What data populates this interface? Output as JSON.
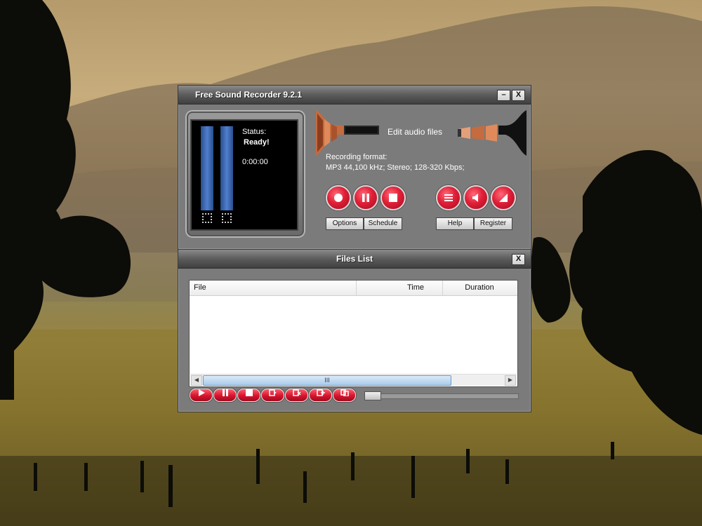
{
  "main_window": {
    "title": "Free Sound Recorder 9.2.1",
    "minimize_glyph": "–",
    "close_glyph": "X"
  },
  "display": {
    "status_label": "Status:",
    "status_value": "Ready!",
    "time": "0:00:00"
  },
  "recording": {
    "edit_audio_label": "Edit audio files",
    "format_label": "Recording format:",
    "format_value": "MP3 44,100 kHz; Stereo;  128-320 Kbps;"
  },
  "buttons": {
    "options": "Options",
    "schedule": "Schedule",
    "help": "Help",
    "register": "Register"
  },
  "files_window": {
    "title": "Files List",
    "close_glyph": "X",
    "columns": [
      "File",
      "Time",
      "Duration"
    ],
    "scroll_thumb_glyph": "III"
  },
  "playback_progress": 0.0,
  "colors": {
    "accent_red": "#e01f37",
    "meter_blue": "#4f7fce",
    "window_gray": "#7b7b7b"
  },
  "icons": {
    "record": "record-icon",
    "pause": "pause-icon",
    "stop": "stop-icon",
    "list": "list-icon",
    "volume": "volume-icon",
    "input_level": "input-level-icon",
    "play": "play-icon",
    "convert": "convert-icon",
    "delete": "delete-icon",
    "add": "add-icon",
    "copy": "copy-icon"
  }
}
